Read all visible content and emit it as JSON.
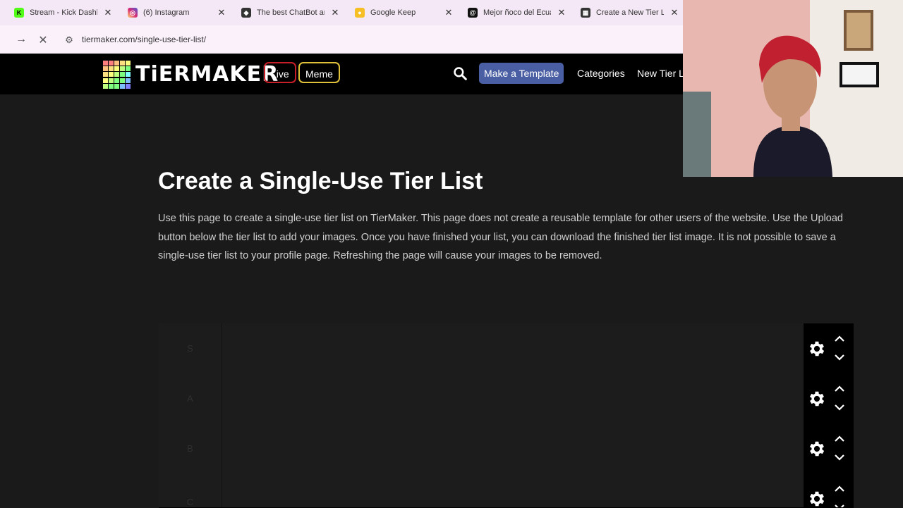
{
  "tabs": [
    {
      "title": "Stream - Kick Dashboard",
      "icon": "kick-icon",
      "color": "#53fc18",
      "glyph": "K"
    },
    {
      "title": "(6) Instagram",
      "icon": "instagram-icon",
      "color": "#d62976",
      "glyph": "◎"
    },
    {
      "title": "The best ChatBot and",
      "icon": "chatbot-icon",
      "color": "#333333",
      "glyph": "◆"
    },
    {
      "title": "Google Keep",
      "icon": "google-keep-icon",
      "color": "#f6bf26",
      "glyph": "●"
    },
    {
      "title": "Mejor ñoco del Ecuador",
      "icon": "threads-icon",
      "color": "#111111",
      "glyph": "@"
    },
    {
      "title": "Create a New Tier List",
      "icon": "tiermaker-icon",
      "color": "#333333",
      "glyph": "▦"
    }
  ],
  "address_bar": {
    "url": "tiermaker.com/single-use-tier-list/"
  },
  "header": {
    "logo_text": "TiERMAKER",
    "live_label": "Live",
    "meme_label": "Meme",
    "make_template_label": "Make a Template",
    "categories_label": "Categories",
    "new_tier_list_label": "New Tier L"
  },
  "main": {
    "title": "Create a Single-Use Tier List",
    "description": "Use this page to create a single-use tier list on TierMaker. This page does not create a reusable template for other users of the website. Use the Upload button below the tier list to add your images. Once you have finished your list, you can download the finished tier list image. It is not possible to save a single-use tier list to your profile page. Refreshing the page will cause your images to be removed."
  },
  "tiers": [
    "S",
    "A",
    "B",
    "C"
  ],
  "colors": {
    "live_border": "#c81e28",
    "meme_border": "#e0c23a",
    "make_template_bg": "#4a5fa3"
  }
}
